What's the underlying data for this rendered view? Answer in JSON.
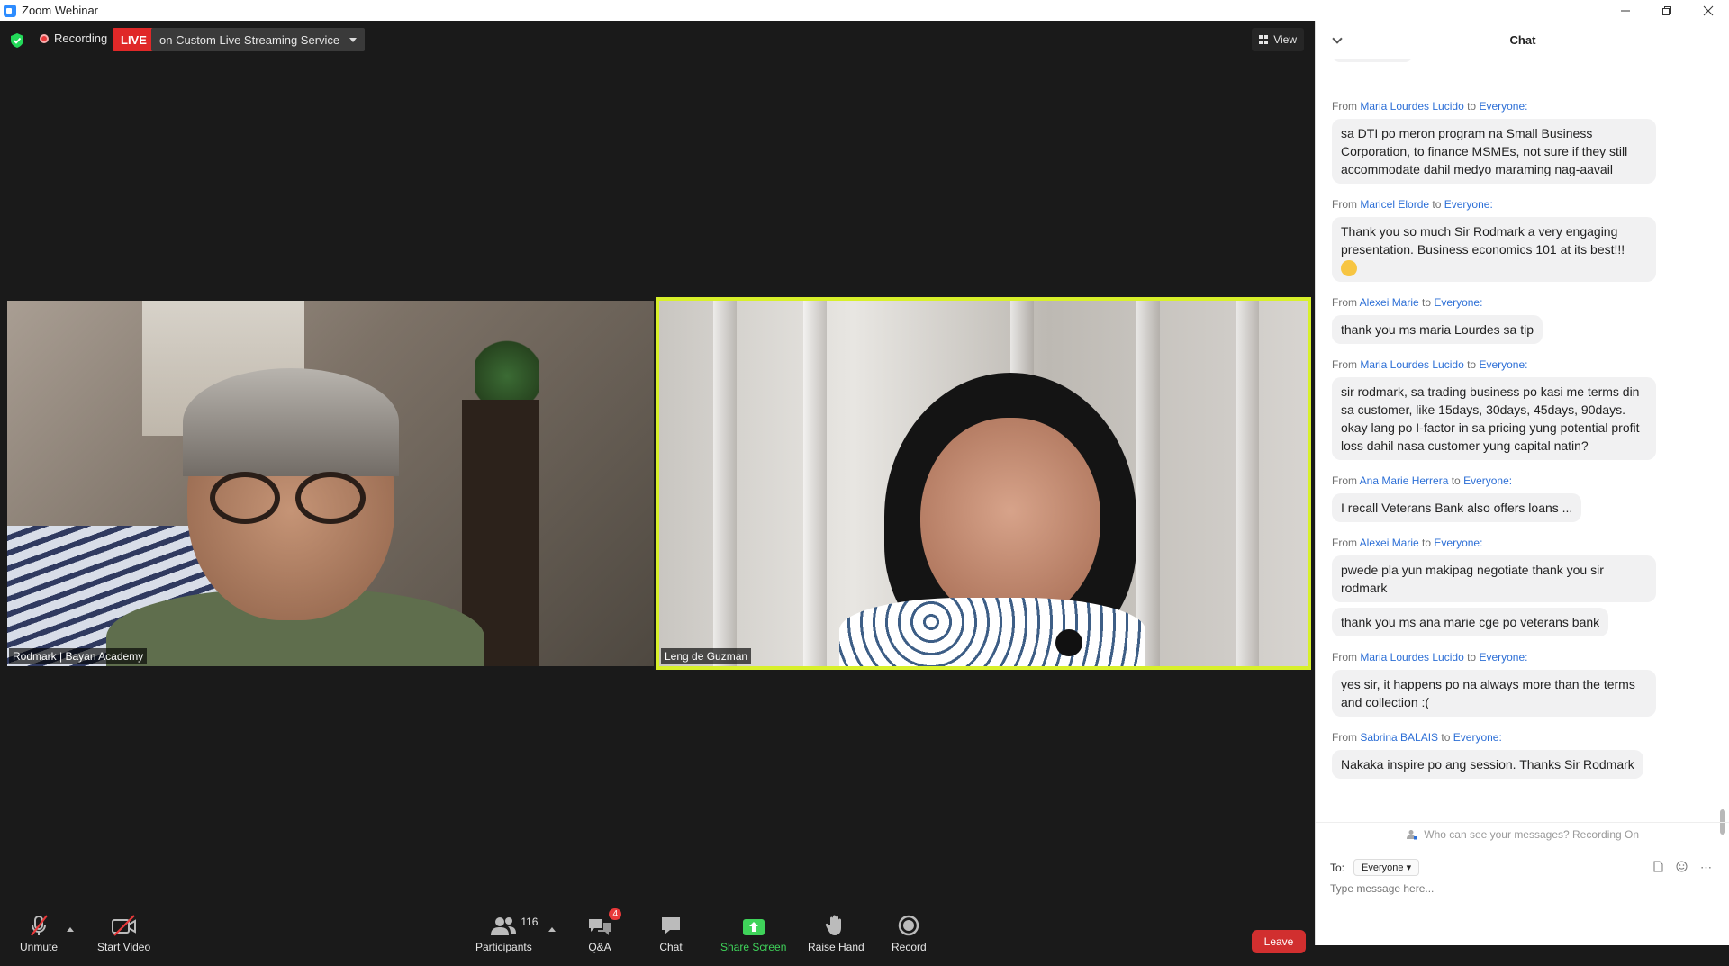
{
  "window": {
    "title": "Zoom Webinar"
  },
  "top_bar": {
    "recording_label": "Recording",
    "live_label": "LIVE",
    "live_service": "on Custom Live Streaming Service",
    "view_label": "View"
  },
  "videos": [
    {
      "name": "Rodmark | Bayan Academy"
    },
    {
      "name": "Leng de Guzman"
    }
  ],
  "toolbar": {
    "unmute": "Unmute",
    "start_video": "Start Video",
    "participants": "Participants",
    "participant_count": "116",
    "qa": "Q&A",
    "qa_badge": "4",
    "chat": "Chat",
    "share_screen": "Share Screen",
    "raise_hand": "Raise Hand",
    "record": "Record",
    "leave": "Leave"
  },
  "chat": {
    "title": "Chat",
    "privacy_note": "Who can see your messages? Recording On",
    "to_label": "To:",
    "recipient": "Everyone",
    "placeholder": "Type message here...",
    "messages": [
      {
        "from": "Maria Lourdes Lucido",
        "to": "Everyone:",
        "texts": [
          "sa DTI po meron program na Small Business Corporation, to finance MSMEs, not sure if they still accommodate dahil medyo maraming nag-aavail"
        ]
      },
      {
        "from": "Maricel Elorde",
        "to": "Everyone:",
        "texts": [
          "Thank you so much Sir Rodmark a very engaging presentation. Business economics 101 at its best!!!"
        ]
      },
      {
        "from": "Alexei Marie",
        "to": "Everyone:",
        "texts": [
          "thank you ms maria Lourdes sa tip"
        ]
      },
      {
        "from": "Maria Lourdes Lucido",
        "to": "Everyone:",
        "texts": [
          "sir rodmark, sa trading business po kasi me terms din sa customer, like 15days, 30days, 45days, 90days. okay lang po I-factor in sa pricing yung potential profit loss dahil nasa customer yung capital natin?"
        ]
      },
      {
        "from": "Ana Marie Herrera",
        "to": "Everyone:",
        "texts": [
          "I recall Veterans Bank also offers loans ..."
        ]
      },
      {
        "from": "Alexei Marie",
        "to": "Everyone:",
        "texts": [
          "pwede pla yun makipag negotiate thank you sir rodmark",
          "thank you ms ana marie cge po veterans bank"
        ]
      },
      {
        "from": "Maria Lourdes Lucido",
        "to": "Everyone:",
        "texts": [
          "yes sir, it happens po na always more than the terms and collection :("
        ]
      },
      {
        "from": "Sabrina BALAIS",
        "to": "Everyone:",
        "texts": [
          "Nakaka inspire po ang session. Thanks Sir Rodmark"
        ]
      }
    ],
    "from_prefix": "From",
    "to_word": "to"
  },
  "colors": {
    "accent_blue": "#2d6fd6",
    "live_red": "#e02828",
    "share_green": "#3fd35a",
    "active_speaker": "#d8f02a",
    "leave_red": "#d12f2f"
  }
}
